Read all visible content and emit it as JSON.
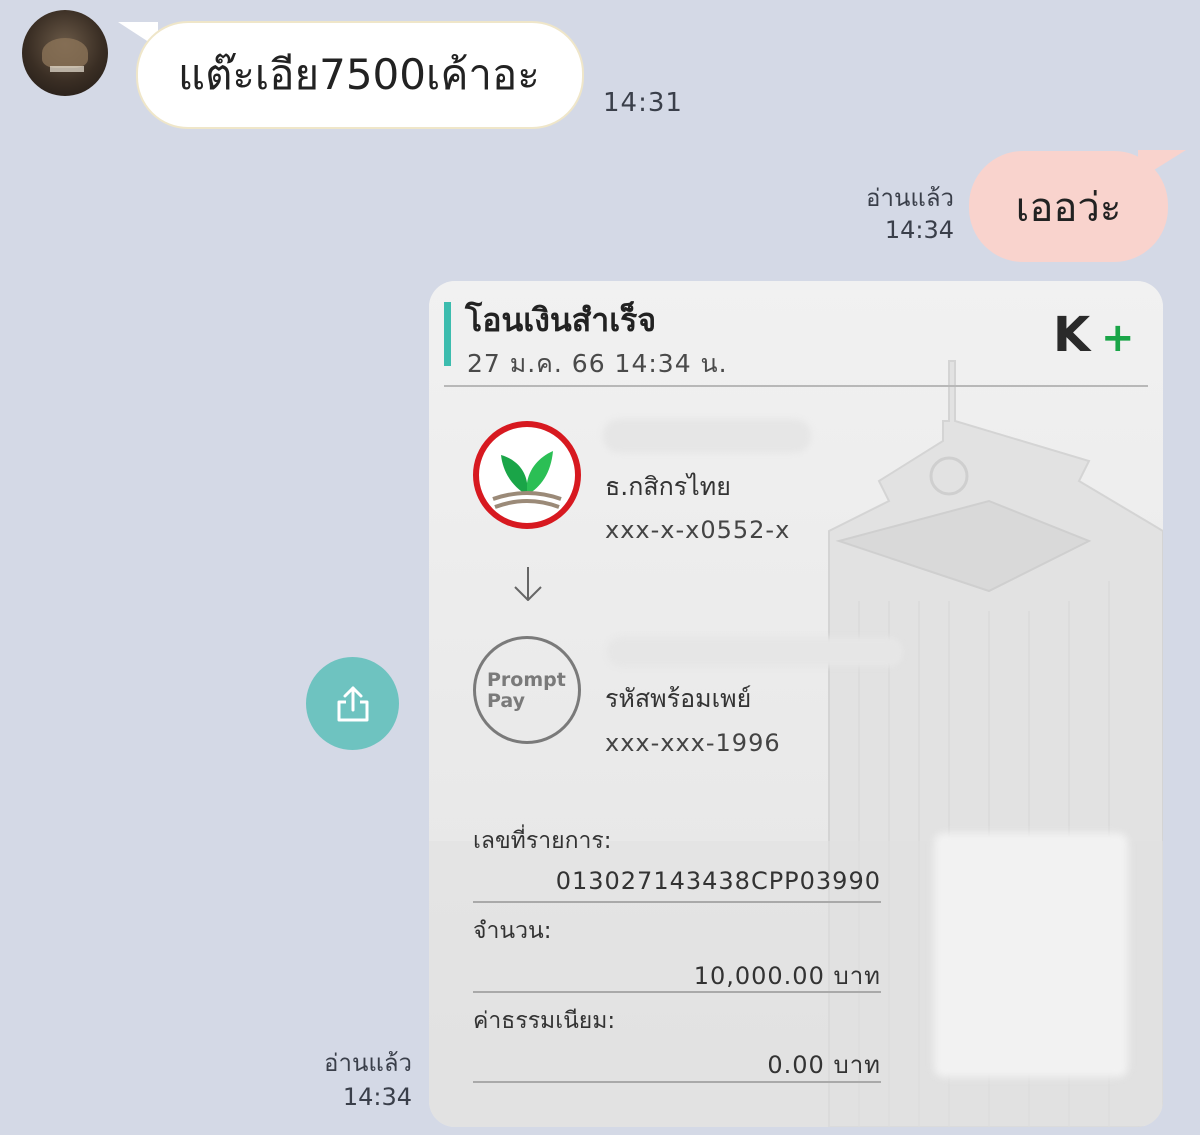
{
  "messages": {
    "incoming": {
      "text": "แต๊ะเอีย7500เค้าอะ",
      "time": "14:31"
    },
    "outgoing_text": {
      "text": "เออว่ะ",
      "read_label": "อ่านแล้ว",
      "time": "14:34"
    },
    "outgoing_slip": {
      "read_label": "อ่านแล้ว",
      "time": "14:34"
    }
  },
  "slip": {
    "title": "โอนเงินสำเร็จ",
    "datetime": "27 ม.ค. 66  14:34 น.",
    "brand": "K+",
    "from": {
      "bank": "ธ.กสิกรไทย",
      "account": "xxx-x-x0552-x"
    },
    "to": {
      "logo_line1": "Prompt",
      "logo_line2": "Pay",
      "type": "รหัสพร้อมเพย์",
      "account": "xxx-xxx-1996"
    },
    "transaction_no_label": "เลขที่รายการ:",
    "transaction_no": "013027143438CPP03990",
    "amount_label": "จำนวน:",
    "amount": "10,000.00 บาท",
    "fee_label": "ค่าธรรมเนียม:",
    "fee": "0.00 บาท"
  },
  "colors": {
    "background": "#d4d9e6",
    "incoming_bubble": "#ffffff",
    "outgoing_bubble": "#f9d3cd",
    "share_button": "#6ec3c0",
    "slip_accent": "#3cbcae",
    "kbank_green": "#1aa548",
    "kbank_red": "#d71920"
  },
  "icons": {
    "share": "share-icon",
    "arrow": "arrow-down-icon"
  }
}
